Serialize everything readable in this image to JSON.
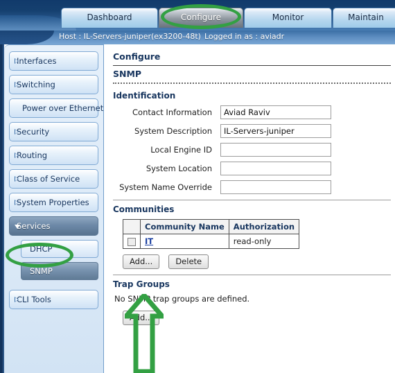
{
  "header": {
    "tabs": [
      {
        "id": "dashboard",
        "label": "Dashboard",
        "selected": false
      },
      {
        "id": "configure",
        "label": "Configure",
        "selected": true
      },
      {
        "id": "monitor",
        "label": "Monitor",
        "selected": false
      },
      {
        "id": "maintain",
        "label": "Maintain",
        "selected": false
      }
    ],
    "host_label": "Host : IL-Servers-juniper(ex3200-48t)",
    "login_label": "Logged in as : aviadr"
  },
  "sidebar": {
    "items": [
      {
        "label": "Interfaces",
        "icon": "triangle-right-icon",
        "state": "collapsed"
      },
      {
        "label": "Switching",
        "icon": "triangle-right-icon",
        "state": "collapsed"
      },
      {
        "label": "Power over Ethernet",
        "icon": "none",
        "state": "plain"
      },
      {
        "label": "Security",
        "icon": "triangle-right-icon",
        "state": "collapsed"
      },
      {
        "label": "Routing",
        "icon": "triangle-right-icon",
        "state": "collapsed"
      },
      {
        "label": "Class of Service",
        "icon": "triangle-right-icon",
        "state": "collapsed"
      },
      {
        "label": "System Properties",
        "icon": "triangle-right-icon",
        "state": "collapsed"
      },
      {
        "label": "Services",
        "icon": "triangle-down-icon",
        "state": "expanded"
      }
    ],
    "subitems": [
      {
        "label": "DHCP",
        "active": false
      },
      {
        "label": "SNMP",
        "active": true
      }
    ],
    "trailing": [
      {
        "label": "CLI Tools",
        "icon": "triangle-right-icon",
        "state": "collapsed"
      }
    ]
  },
  "main": {
    "page_title": "Configure",
    "sub_title": "SNMP",
    "identification": {
      "heading": "Identification",
      "fields": [
        {
          "label": "Contact Information",
          "value": "Aviad Raviv"
        },
        {
          "label": "System Description",
          "value": "IL-Servers-juniper"
        },
        {
          "label": "Local Engine ID",
          "value": ""
        },
        {
          "label": "System Location",
          "value": ""
        },
        {
          "label": "System Name Override",
          "value": ""
        }
      ]
    },
    "communities": {
      "heading": "Communities",
      "columns": [
        "",
        "Community Name",
        "Authorization"
      ],
      "rows": [
        {
          "checked": false,
          "name": "IT",
          "authorization": "read-only"
        }
      ],
      "add_label": "Add...",
      "delete_label": "Delete"
    },
    "trap_groups": {
      "heading": "Trap Groups",
      "empty_message": "No SNMP trap groups are defined.",
      "add_label": "Add..."
    }
  },
  "annotations": {
    "color": "#33a043",
    "items": [
      {
        "name": "highlight-ellipse-configure-tab",
        "shape": "ellipse"
      },
      {
        "name": "highlight-ellipse-snmp-nav",
        "shape": "ellipse"
      },
      {
        "name": "highlight-arrow-communities-add",
        "shape": "arrow-up"
      }
    ]
  }
}
